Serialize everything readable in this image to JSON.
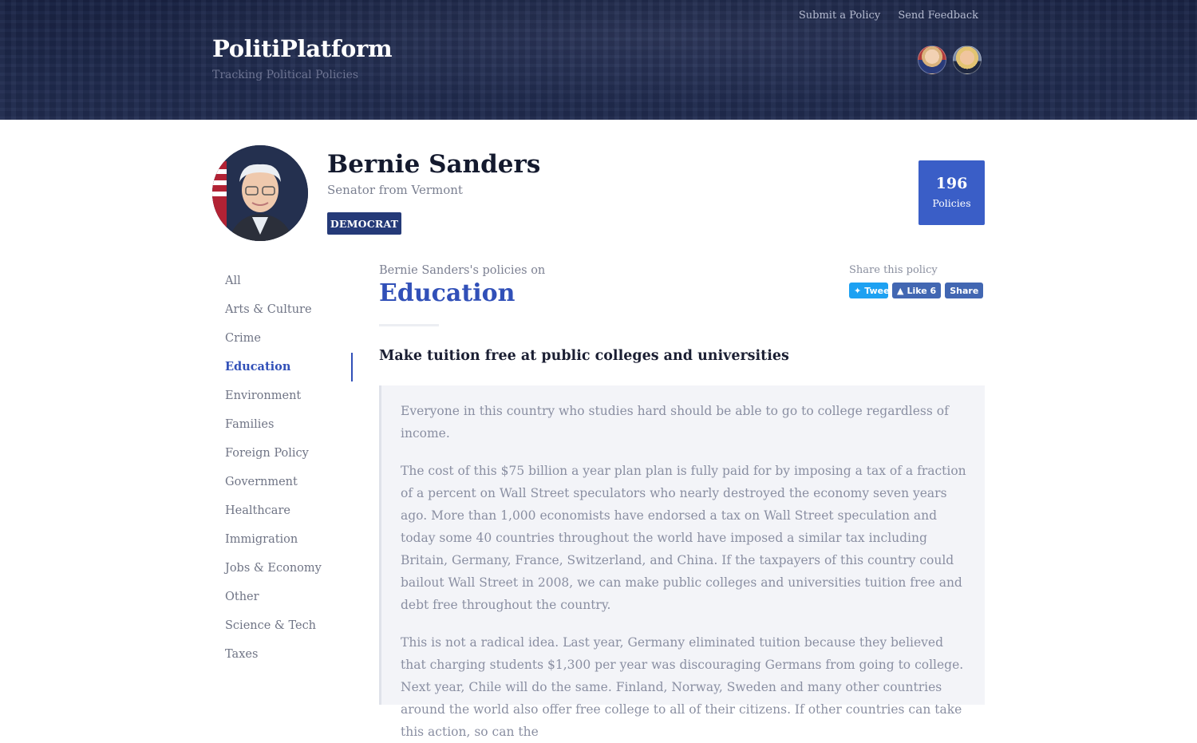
{
  "site": {
    "name": "PolitiPlatform",
    "tagline": "Tracking Political Policies",
    "nav": [
      "Submit a Policy",
      "Send Feedback"
    ]
  },
  "profile": {
    "name": "Bernie Sanders",
    "title": "Senator from Vermont",
    "party": "DEMOCRAT",
    "policy_count": "196",
    "policy_count_label": "Policies"
  },
  "sidebar": {
    "categories": [
      "All",
      "Arts & Culture",
      "Crime",
      "Education",
      "Environment",
      "Families",
      "Foreign Policy",
      "Government",
      "Healthcare",
      "Immigration",
      "Jobs & Economy",
      "Other",
      "Science & Tech",
      "Taxes"
    ],
    "active": "Education"
  },
  "content": {
    "pre_title": "Bernie Sanders's policies on",
    "topic": "Education",
    "share_label": "Share this policy",
    "share_buttons": {
      "tweet": "Tweet",
      "like": "Like 6",
      "share": "Share"
    },
    "policy_title": "Make tuition free at public colleges and universities",
    "paragraphs": [
      "Everyone in this country who studies hard should be able to go to college regardless of income.",
      "The cost of this $75 billion a year plan plan is fully paid for by imposing a tax of a fraction of a percent on Wall Street speculators who nearly destroyed the economy seven years ago. More than 1,000 economists have endorsed a tax on Wall Street speculation and today some 40 countries throughout the world have imposed a similar tax including Britain, Germany, France, Switzerland, and China. If the taxpayers of this country could bailout Wall Street in 2008, we can make public colleges and universities tuition free and debt free throughout the country.",
      "This is not a radical idea. Last year, Germany eliminated tuition because they believed that charging students $1,300 per year was discouraging Germans from going to college. Next year, Chile will do the same. Finland, Norway, Sweden and many other countries around the world also offer free college to all of their citizens. If other countries can take this action, so can the"
    ]
  },
  "colors": {
    "header_bg": "#1f2a4e",
    "accent": "#3150b8",
    "badge": "#253a78",
    "count_box": "#3a5ec7",
    "twitter": "#1da1f2",
    "facebook": "#4267b2"
  },
  "icons": {
    "tweet": "twitter-bird-icon",
    "like": "thumbs-up-icon"
  }
}
